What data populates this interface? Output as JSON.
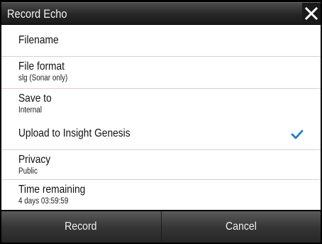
{
  "dialog": {
    "title": "Record Echo",
    "close_icon": "close-x-icon"
  },
  "rows": [
    {
      "label": "Filename"
    },
    {
      "label": "File format",
      "value": "slg (Sonar only)"
    },
    {
      "label": "Save to",
      "value": "Internal"
    },
    {
      "label": "Upload to Insight Genesis",
      "checked": true
    },
    {
      "label": "Privacy",
      "value": "Public"
    },
    {
      "label": "Time remaining",
      "value": "4 days 03:59:59"
    }
  ],
  "footer": {
    "record_label": "Record",
    "cancel_label": "Cancel"
  },
  "colors": {
    "accent": "#1a7fc6",
    "separator": "#e6c8cc"
  }
}
